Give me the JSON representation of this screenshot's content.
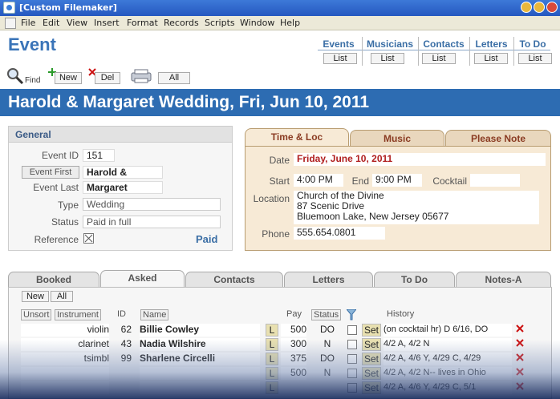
{
  "window": {
    "title": "[Custom Filemaker]"
  },
  "menu": [
    "File",
    "Edit",
    "View",
    "Insert",
    "Format",
    "Records",
    "Scripts",
    "Window",
    "Help"
  ],
  "header": {
    "title": "Event",
    "nav": [
      {
        "label": "Events",
        "btn": "List"
      },
      {
        "label": "Musicians",
        "btn": "List"
      },
      {
        "label": "Contacts",
        "btn": "List"
      },
      {
        "label": "Letters",
        "btn": "List"
      },
      {
        "label": "To Do",
        "btn": "List"
      }
    ]
  },
  "toolbar": {
    "find": "Find",
    "new": "New",
    "del": "Del",
    "all": "All"
  },
  "banner": "Harold & Margaret Wedding, Fri, Jun 10, 2011",
  "general": {
    "title": "General",
    "event_id_label": "Event ID",
    "event_id": "151",
    "event_first_btn": "Event First",
    "event_first": "Harold &",
    "event_last_label": "Event Last",
    "event_last": "Margaret",
    "type_label": "Type",
    "type": "Wedding",
    "status_label": "Status",
    "status": "Paid in full",
    "reference_label": "Reference",
    "paid": "Paid"
  },
  "timeloc": {
    "tabs": [
      "Time & Loc",
      "Music",
      "Please Note"
    ],
    "date_label": "Date",
    "date": "Friday, June 10, 2011",
    "start_label": "Start",
    "start": "4:00 PM",
    "end_label": "End",
    "end": "9:00 PM",
    "cocktail_label": "Cocktail",
    "cocktail": "",
    "location_label": "Location",
    "location_lines": [
      "Church of the Divine",
      "87 Scenic Drive",
      "Bluemoon Lake, New Jersey 05677"
    ],
    "phone_label": "Phone",
    "phone": "555.654.0801"
  },
  "bottom": {
    "tabs": [
      "Booked",
      "Asked",
      "Contacts",
      "Letters",
      "To Do",
      "Notes-A"
    ],
    "btn_new": "New",
    "btn_all": "All",
    "columns": {
      "unsort": "Unsort",
      "instrument": "Instrument",
      "id": "ID",
      "name": "Name",
      "pay": "Pay",
      "status": "Status",
      "history": "History"
    },
    "rows": [
      {
        "instrument": "violin",
        "id": "62",
        "name": "Billie Cowley",
        "l": "L",
        "pay": "500",
        "status": "DO",
        "set": "Set",
        "history": "(on cocktail hr) D 6/16, DO"
      },
      {
        "instrument": "clarinet",
        "id": "43",
        "name": "Nadia Wilshire",
        "l": "L",
        "pay": "300",
        "status": "N",
        "set": "Set",
        "history": "4/2 A, 4/2 N"
      },
      {
        "instrument": "tsimbl",
        "id": "99",
        "name": "Sharlene Circelli",
        "l": "L",
        "pay": "375",
        "status": "DO",
        "set": "Set",
        "history": "4/2 A, 4/6 Y, 4/29 C, 4/29"
      },
      {
        "instrument": "",
        "id": "",
        "name": "",
        "l": "L",
        "pay": "500",
        "status": "N",
        "set": "Set",
        "history": "4/2 A, 4/2 N-- lives in Ohio"
      },
      {
        "instrument": "",
        "id": "",
        "name": "",
        "l": "L",
        "pay": "",
        "status": "",
        "set": "Set",
        "history": "4/2 A, 4/6 Y, 4/29 C, 5/1"
      }
    ]
  },
  "colors": {
    "accent": "#2d6cb2",
    "tab_text": "#8a3b22",
    "date_red": "#b01e1e",
    "delete_red": "#cc1111"
  }
}
